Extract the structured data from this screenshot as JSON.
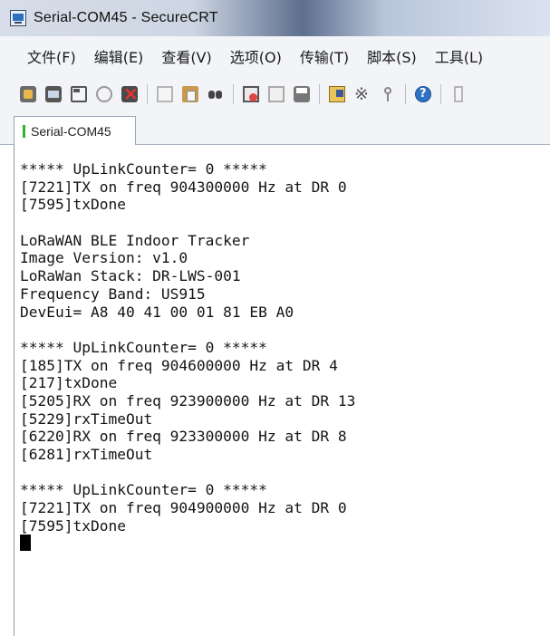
{
  "window": {
    "title": "Serial-COM45 - SecureCRT"
  },
  "menu": {
    "items": [
      {
        "label": "文件(F)"
      },
      {
        "label": "编辑(E)"
      },
      {
        "label": "查看(V)"
      },
      {
        "label": "选项(O)"
      },
      {
        "label": "传输(T)"
      },
      {
        "label": "脚本(S)"
      },
      {
        "label": "工具(L)"
      }
    ]
  },
  "toolbar": {
    "icons": [
      "connect-icon",
      "quick-connect-icon",
      "connect-in-tab-icon",
      "reconnect-icon",
      "disconnect-icon",
      "copy-icon",
      "paste-icon",
      "find-icon",
      "print-setup-icon",
      "print-selection-icon",
      "print-icon",
      "session-options-icon",
      "global-options-icon",
      "keymap-icon",
      "help-icon",
      "more-icon"
    ]
  },
  "tabs": [
    {
      "label": "Serial-COM45",
      "status_color": "#2fb531",
      "active": true
    }
  ],
  "terminal": {
    "lines": [
      "***** UpLinkCounter= 0 *****",
      "[7221]TX on freq 904300000 Hz at DR 0",
      "[7595]txDone",
      "",
      "LoRaWAN BLE Indoor Tracker",
      "Image Version: v1.0",
      "LoRaWan Stack: DR-LWS-001",
      "Frequency Band: US915",
      "DevEui= A8 40 41 00 01 81 EB A0",
      "",
      "***** UpLinkCounter= 0 *****",
      "[185]TX on freq 904600000 Hz at DR 4",
      "[217]txDone",
      "[5205]RX on freq 923900000 Hz at DR 13",
      "[5229]rxTimeOut",
      "[6220]RX on freq 923300000 Hz at DR 8",
      "[6281]rxTimeOut",
      "",
      "***** UpLinkCounter= 0 *****",
      "[7221]TX on freq 904900000 Hz at DR 0",
      "[7595]txDone"
    ]
  }
}
